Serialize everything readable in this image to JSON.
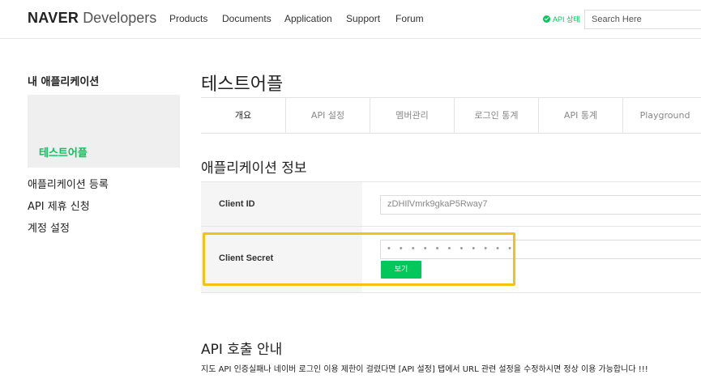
{
  "header": {
    "logo_brand": "NAVER",
    "logo_sub": "Developers",
    "nav": [
      "Products",
      "Documents",
      "Application",
      "Support",
      "Forum"
    ],
    "status_label": "API 상태",
    "search_placeholder": "Search Here"
  },
  "sidebar": {
    "title": "내 애플리케이션",
    "active_app": "테스트어플",
    "links": [
      "애플리케이션 등록",
      "API 제휴 신청",
      "계정 설정"
    ]
  },
  "main": {
    "app_title": "테스트어플",
    "tabs": [
      "개요",
      "API 설정",
      "멤버관리",
      "로그인 통계",
      "API 통계",
      "Playground"
    ],
    "section_title": "애플리케이션 정보",
    "client_id_label": "Client ID",
    "client_id_value": "zDHIlVmrk9gkaP5Rway7",
    "client_secret_label": "Client Secret",
    "client_secret_value": "• • • • • • • • • • •",
    "view_button": "보기",
    "api_title": "API 호출 안내",
    "api_desc": "지도 API 인증실패나 네이버 로그인 이용 제한이 걸렸다면 [API 설정] 탭에서 URL 관련 설정을 수정하시면 정상 이용 가능합니다 !!!"
  },
  "colors": {
    "accent": "#03c75a",
    "highlight": "#f2c216"
  }
}
